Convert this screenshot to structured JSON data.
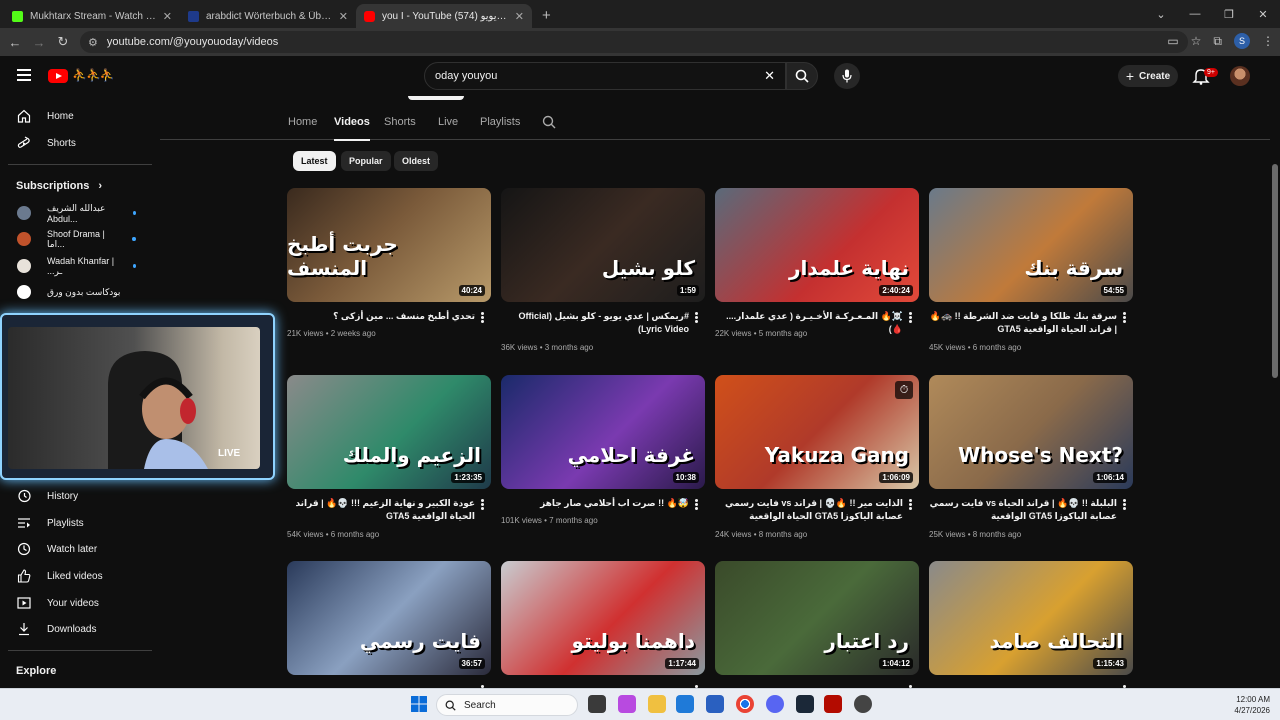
{
  "browser": {
    "tabs": [
      {
        "title": "Mukhtarx Stream - Watch Live o",
        "color": "#53fc18"
      },
      {
        "title": "arabdict Wörterbuch & Übersetz",
        "color": "#1e3a8a"
      },
      {
        "title": "you I - YouTube عدي يويو (574)",
        "color": "#ff0000"
      }
    ],
    "url": "youtube.com/@youyouoday/videos",
    "profile_letter": "S"
  },
  "header": {
    "search_value": "oday youyou",
    "create_label": "Create",
    "notif_badge": "9+"
  },
  "sidebar": {
    "main": [
      {
        "label": "Home",
        "icon": "home-icon"
      },
      {
        "label": "Shorts",
        "icon": "shorts-icon"
      }
    ],
    "subscriptions_title": "Subscriptions",
    "subscriptions": [
      {
        "label": "عبدالله الشريف Abdul...",
        "color": "#6b7a8f"
      },
      {
        "label": "Shoof Drama | اما...",
        "color": "#c0522b"
      },
      {
        "label": "Wadah Khanfar | ...ـر",
        "color": "#e8e2da"
      },
      {
        "label": "بودكاست بدون ورق",
        "color": "#ffffff"
      }
    ],
    "you": [
      {
        "label": "History",
        "icon": "history-icon"
      },
      {
        "label": "Playlists",
        "icon": "playlists-icon"
      },
      {
        "label": "Watch later",
        "icon": "watch-later-icon"
      },
      {
        "label": "Liked videos",
        "icon": "liked-icon"
      },
      {
        "label": "Your videos",
        "icon": "your-videos-icon"
      },
      {
        "label": "Downloads",
        "icon": "downloads-icon"
      }
    ],
    "explore_title": "Explore"
  },
  "webcam": {
    "live_label": "LIVE"
  },
  "channel_tabs": [
    "Home",
    "Videos",
    "Shorts",
    "Live",
    "Playlists"
  ],
  "chips": [
    "Latest",
    "Popular",
    "Oldest"
  ],
  "videos": [
    {
      "title": "تحدي أطبخ منسف ... مين أزكى ؟",
      "views": "21K views",
      "age": "2 weeks ago",
      "duration": "40:24",
      "overlay": "جربت أطبخ المنسف",
      "bg": "linear-gradient(135deg,#3a2a1e,#7a5a3a 45%,#b89a6a)"
    },
    {
      "title": "#ريمكس | عدي يويو - كلو بشيل (Official Lyric Video)",
      "views": "36K views",
      "age": "3 months ago",
      "duration": "1:59",
      "overlay": "كلو بشيل",
      "bg": "linear-gradient(135deg,#151515,#3a2a22 50%,#1d1d1d)"
    },
    {
      "title": "☠️🔥 المـعـركـة الأخـيـرة ( عدي علمدار.... 🩸)",
      "views": "22K views",
      "age": "5 months ago",
      "duration": "2:40:24",
      "overlay": "نهاية علمدار",
      "bg": "linear-gradient(135deg,#5a6a7a,#c43030 60%,#e24a3a)"
    },
    {
      "title": "سرقة بنك ظلكا و فايت ضد الشرطة !! 🚓🔥 | قراند الحياة الواقعية GTA5",
      "views": "45K views",
      "age": "6 months ago",
      "duration": "54:55",
      "overlay": "سرقة بنك",
      "bg": "linear-gradient(135deg,#6a7a8a,#c07a3a 55%,#4a4a4a)"
    },
    {
      "title": "عودة الكبير و نهاية الزعيم !!! 💀🔥 | قراند الحياة الواقعية GTA5",
      "views": "54K views",
      "age": "6 months ago",
      "duration": "1:23:35",
      "overlay": "الزعيم والملك",
      "bg": "linear-gradient(135deg,#8a8a8a,#2f8a6a 55%,#1f3a4a)"
    },
    {
      "title": "🤯🔥 !! صرت اب أحلامي صار جاهز",
      "views": "101K views",
      "age": "7 months ago",
      "duration": "10:38",
      "overlay": "غرفة احلامي",
      "bg": "linear-gradient(135deg,#1a2a6a,#7a3ab0 55%,#2a1a4a)"
    },
    {
      "title": "الذايت مير !! 🔥💀 | قراند vs فايت رسمي عصابة الياكوزا GTA5 الحياة الواقعية",
      "views": "24K views",
      "age": "8 months ago",
      "duration": "1:06:09",
      "overlay": "Yakuza Gang",
      "bg": "linear-gradient(135deg,#d0501a,#b03a2a 50%,#d8c8a8)"
    },
    {
      "title": "البلبلة !! 💀🔥 | قراند الحياة vs فايت رسمي عصابة الياكوزا GTA5 الواقعية",
      "views": "25K views",
      "age": "8 months ago",
      "duration": "1:06:14",
      "overlay": "Whose's Next?",
      "bg": "linear-gradient(135deg,#b08a5a,#8a6a4a 50%,#2a3a5a)"
    },
    {
      "title": "",
      "views": "",
      "age": "",
      "duration": "36:57",
      "overlay": "فايت رسمي",
      "bg": "linear-gradient(135deg,#2a3a5a,#8aa0c0 50%,#2a2a3a)"
    },
    {
      "title": "",
      "views": "",
      "age": "",
      "duration": "1:17:44",
      "overlay": "داهمنا بوليتو",
      "bg": "linear-gradient(135deg,#c8ccd0,#d03030 55%,#8a9aa0)"
    },
    {
      "title": "",
      "views": "",
      "age": "",
      "duration": "1:04:12",
      "overlay": "رد اعتبار",
      "bg": "linear-gradient(135deg,#3a4a2a,#4a6a3a 50%,#2a2a2a)"
    },
    {
      "title": "",
      "views": "",
      "age": "",
      "duration": "1:15:43",
      "overlay": "التحالف صامد",
      "bg": "linear-gradient(135deg,#8a8a8a,#d8a030 55%,#4a4a4a)"
    }
  ],
  "taskbar": {
    "search_label": "Search",
    "time": "12:00 AM",
    "date": "4/27/2026"
  }
}
